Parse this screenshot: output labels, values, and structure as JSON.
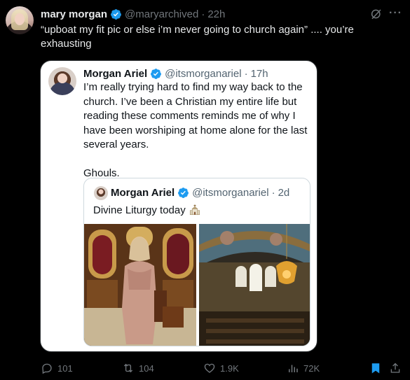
{
  "tweet": {
    "author_name": "mary morgan",
    "author_handle": "@maryarchived",
    "separator": "·",
    "time": "22h",
    "text": "“upboat my fit pic or else i’m never going to church again” .... you’re exhausting"
  },
  "quoted_tweet": {
    "author_name": "Morgan Ariel",
    "author_handle": "@itsmorganariel",
    "separator": "·",
    "time": "17h",
    "text_paragraph_1": "I’m really trying hard to find my way back to the church. I’ve been a Christian my entire life but reading these comments reminds me of why I have been worshiping at home alone for the last several years.",
    "text_paragraph_2": "Ghouls.",
    "nested_quote": {
      "author_name": "Morgan Ariel",
      "author_handle": "@itsmorganariel",
      "separator": "·",
      "time": "2d",
      "text": "Divine Liturgy today",
      "emoji_icon": "church-icon"
    }
  },
  "actions": {
    "replies": "101",
    "reposts": "104",
    "likes": "1.9K",
    "views": "72K"
  },
  "colors": {
    "background": "#000000",
    "text_primary": "#e7e9ea",
    "text_secondary": "#71767b",
    "verified_blue": "#1d9bf0",
    "repost_green": "#00ba7c",
    "bookmark_blue": "#1d9bf0"
  }
}
